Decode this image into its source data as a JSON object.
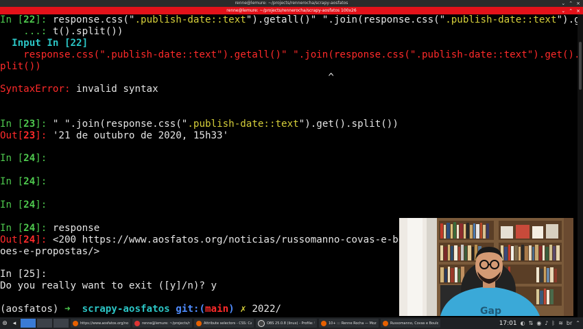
{
  "window1_title": "renne@lemure: ~/projects/rennerocha/scrapy-aosfatos",
  "window2_title": "renne@lemure: ~/projects/rennerocha/scrapy-aosfatos 100x26",
  "terminal": {
    "l1a": "In [",
    "l1n": "22",
    "l1b": "]: ",
    "l1c": "response.css(\"",
    "l1s1": ".publish-date::text",
    "l1d": "\").getall()\" \".join(response.css(\"",
    "l1s2": ".publish-date::text",
    "l1e": "\").ge",
    "l2a": "    ...: ",
    "l2b": "t().split())",
    "l3": "  Input In [22]",
    "l4": "    response.css(\".publish-date::text\").getall()\" \".join(response.css(\".publish-date::text\").get().s",
    "l5": "plit())",
    "l6": "                                                        ^",
    "l7a": "SyntaxError:",
    "l7b": " invalid syntax",
    "l8a": "In [",
    "l8n": "23",
    "l8b": "]: ",
    "l8c": "\" \".join(response.css(\"",
    "l8s": ".publish-date::text",
    "l8d": "\").get().split())",
    "l9a": "Out[",
    "l9n": "23",
    "l9b": "]: ",
    "l9c": "'21 de outubro de 2020, 15h33'",
    "in24a": "In [",
    "in24n": "24",
    "in24b": "]:",
    "l14c": " response",
    "l15a": "Out[",
    "l15n": "24",
    "l15b": "]: ",
    "l15c": "<200 https://www.aosfatos.org/noticias/russomanno-covas-e-bo",
    "l16": "oes-e-propostas/>",
    "l17": "In [25]:",
    "l18": "Do you really want to exit ([y]/n)? y",
    "l19a": "(aosfatos) ",
    "l19arrow": "➜ ",
    "l19dir": " scrapy-aosfatos ",
    "l19git": "git:(",
    "l19branch": "main",
    "l19gitc": ")",
    "l19x": " ✗",
    "l19c": " 2022/"
  },
  "webcam": {
    "icon": "webcam-person-video"
  },
  "taskbar": {
    "items": [
      "https://www.aosfatos.org/noti...",
      "renne@lemure: ~/projects/ren...",
      "Attribute selectors - CSS: Casc...",
      "OBS 25.0.8 (linux) - Profile: Unt...",
      "10+ ::: Renne Rocha — Mozil...",
      "Russomanno, Covas e Boulos..."
    ],
    "clock": "17:01",
    "lang": "br"
  },
  "colors": {
    "prompt_green": "#4ec94e",
    "error_red": "#ff2a2a",
    "string_yellow": "#d6cf3a",
    "cyan": "#2bc4c4",
    "title_red": "#e3121a"
  }
}
